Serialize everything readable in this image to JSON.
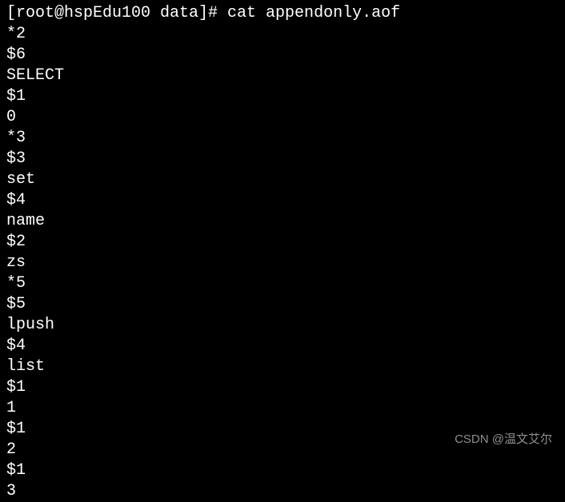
{
  "prompt": "[root@hspEdu100 data]# cat appendonly.aof",
  "lines": [
    "*2",
    "$6",
    "SELECT",
    "$1",
    "0",
    "*3",
    "$3",
    "set",
    "$4",
    "name",
    "$2",
    "zs",
    "*5",
    "$5",
    "lpush",
    "$4",
    "list",
    "$1",
    "1",
    "$1",
    "2",
    "$1",
    "3"
  ],
  "watermark": "CSDN @温文艾尔"
}
